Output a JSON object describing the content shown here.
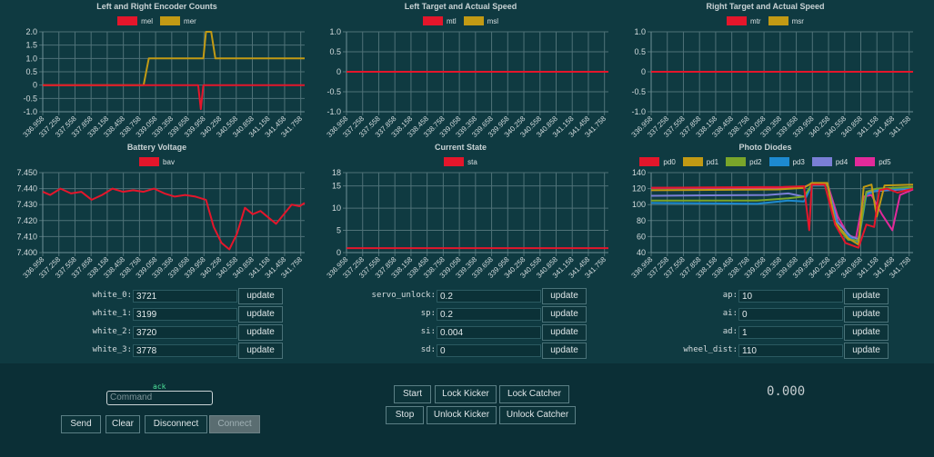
{
  "charts": [
    {
      "title": "Left and Right Encoder Counts",
      "legend": [
        {
          "name": "mel",
          "color": "#e4162b"
        },
        {
          "name": "mer",
          "color": "#c29a14"
        }
      ],
      "yticks": [
        "2.0",
        "1.5",
        "1.0",
        "0.5",
        "0",
        "-0.5",
        "-1.0"
      ]
    },
    {
      "title": "Left Target and Actual Speed",
      "legend": [
        {
          "name": "mtl",
          "color": "#e4162b"
        },
        {
          "name": "msl",
          "color": "#c29a14"
        }
      ],
      "yticks": [
        "1.0",
        "0.5",
        "0",
        "-0.5",
        "-1.0"
      ]
    },
    {
      "title": "Right Target and Actual Speed",
      "legend": [
        {
          "name": "mtr",
          "color": "#e4162b"
        },
        {
          "name": "msr",
          "color": "#c29a14"
        }
      ],
      "yticks": [
        "1.0",
        "0.5",
        "0",
        "-0.5",
        "-1.0"
      ]
    },
    {
      "title": "Battery Voltage",
      "legend": [
        {
          "name": "bav",
          "color": "#e4162b"
        }
      ],
      "yticks": [
        "7.450",
        "7.440",
        "7.430",
        "7.420",
        "7.410",
        "7.400"
      ]
    },
    {
      "title": "Current State",
      "legend": [
        {
          "name": "sta",
          "color": "#e4162b"
        }
      ],
      "yticks": [
        "18",
        "15",
        "10",
        "5",
        "0"
      ]
    },
    {
      "title": "Photo Diodes",
      "legend": [
        {
          "name": "pd0",
          "color": "#e4162b"
        },
        {
          "name": "pd1",
          "color": "#c29a14"
        },
        {
          "name": "pd2",
          "color": "#7aa52a"
        },
        {
          "name": "pd3",
          "color": "#1d8ad0"
        },
        {
          "name": "pd4",
          "color": "#7a7fd6"
        },
        {
          "name": "pd5",
          "color": "#e22a9a"
        }
      ],
      "yticks": [
        "140",
        "120",
        "100",
        "80",
        "60",
        "40"
      ]
    }
  ],
  "xticks": [
    "336.958",
    "337.258",
    "337.558",
    "337.858",
    "338.158",
    "338.458",
    "338.758",
    "339.058",
    "339.358",
    "339.658",
    "339.958",
    "340.258",
    "340.558",
    "340.858",
    "341.158",
    "341.458",
    "341.758"
  ],
  "chart_data": [
    {
      "type": "line",
      "title": "Left and Right Encoder Counts",
      "ylim": [
        -1,
        2
      ],
      "series": [
        {
          "name": "mel",
          "color": "#e4162b",
          "points": [
            [
              336.96,
              0
            ],
            [
              339.95,
              0
            ],
            [
              340.0,
              -0.9
            ],
            [
              340.05,
              0
            ],
            [
              342.0,
              0
            ]
          ]
        },
        {
          "name": "mer",
          "color": "#c29a14",
          "points": [
            [
              336.96,
              0
            ],
            [
              338.9,
              0
            ],
            [
              339.0,
              1
            ],
            [
              339.95,
              1
            ],
            [
              340.05,
              1
            ],
            [
              340.1,
              2
            ],
            [
              340.2,
              2
            ],
            [
              340.28,
              1
            ],
            [
              342.0,
              1
            ]
          ]
        }
      ]
    },
    {
      "type": "line",
      "title": "Left Target and Actual Speed",
      "ylim": [
        -1,
        1
      ],
      "series": [
        {
          "name": "mtl",
          "color": "#e4162b",
          "points": [
            [
              336.96,
              0
            ],
            [
              342.0,
              0
            ]
          ]
        },
        {
          "name": "msl",
          "color": "#c29a14",
          "points": [
            [
              336.96,
              0
            ],
            [
              342.0,
              0
            ]
          ]
        }
      ]
    },
    {
      "type": "line",
      "title": "Right Target and Actual Speed",
      "ylim": [
        -1,
        1
      ],
      "series": [
        {
          "name": "mtr",
          "color": "#e4162b",
          "points": [
            [
              336.96,
              0
            ],
            [
              342.0,
              0
            ]
          ]
        },
        {
          "name": "msr",
          "color": "#c29a14",
          "points": [
            [
              336.96,
              0
            ],
            [
              342.0,
              0
            ]
          ]
        }
      ]
    },
    {
      "type": "line",
      "title": "Battery Voltage",
      "ylim": [
        7.4,
        7.45
      ],
      "series": [
        {
          "name": "bav",
          "color": "#e4162b",
          "points": [
            [
              336.96,
              7.438
            ],
            [
              337.1,
              7.436
            ],
            [
              337.3,
              7.44
            ],
            [
              337.5,
              7.437
            ],
            [
              337.7,
              7.438
            ],
            [
              337.9,
              7.433
            ],
            [
              338.1,
              7.436
            ],
            [
              338.3,
              7.44
            ],
            [
              338.5,
              7.438
            ],
            [
              338.7,
              7.439
            ],
            [
              338.9,
              7.438
            ],
            [
              339.1,
              7.44
            ],
            [
              339.3,
              7.437
            ],
            [
              339.5,
              7.435
            ],
            [
              339.7,
              7.436
            ],
            [
              339.9,
              7.435
            ],
            [
              340.1,
              7.433
            ],
            [
              340.25,
              7.416
            ],
            [
              340.4,
              7.406
            ],
            [
              340.55,
              7.402
            ],
            [
              340.7,
              7.412
            ],
            [
              340.85,
              7.428
            ],
            [
              341.0,
              7.424
            ],
            [
              341.15,
              7.426
            ],
            [
              341.3,
              7.422
            ],
            [
              341.45,
              7.418
            ],
            [
              341.6,
              7.424
            ],
            [
              341.75,
              7.43
            ],
            [
              341.9,
              7.429
            ],
            [
              342.0,
              7.431
            ]
          ]
        }
      ]
    },
    {
      "type": "line",
      "title": "Current State",
      "ylim": [
        0,
        18
      ],
      "series": [
        {
          "name": "sta",
          "color": "#e4162b",
          "points": [
            [
              336.96,
              1
            ],
            [
              342.0,
              1
            ]
          ]
        }
      ]
    },
    {
      "type": "line",
      "title": "Photo Diodes",
      "ylim": [
        40,
        140
      ],
      "series": [
        {
          "name": "pd0",
          "color": "#e4162b",
          "points": [
            [
              336.96,
              121
            ],
            [
              339.5,
              122
            ],
            [
              339.9,
              123
            ],
            [
              340.0,
              68
            ],
            [
              340.05,
              125
            ],
            [
              340.3,
              125
            ],
            [
              340.5,
              75
            ],
            [
              340.7,
              52
            ],
            [
              340.95,
              46
            ],
            [
              341.1,
              75
            ],
            [
              341.25,
              72
            ],
            [
              341.35,
              118
            ],
            [
              341.5,
              120
            ],
            [
              341.7,
              115
            ],
            [
              342.0,
              120
            ]
          ]
        },
        {
          "name": "pd1",
          "color": "#c29a14",
          "points": [
            [
              336.96,
              118
            ],
            [
              339.4,
              119
            ],
            [
              339.9,
              121
            ],
            [
              340.05,
              127
            ],
            [
              340.35,
              127
            ],
            [
              340.5,
              78
            ],
            [
              340.75,
              58
            ],
            [
              340.95,
              50
            ],
            [
              341.05,
              122
            ],
            [
              341.2,
              125
            ],
            [
              341.3,
              85
            ],
            [
              341.45,
              124
            ],
            [
              342.0,
              125
            ]
          ]
        },
        {
          "name": "pd2",
          "color": "#7aa52a",
          "points": [
            [
              336.96,
              105
            ],
            [
              339.0,
              105
            ],
            [
              339.6,
              108
            ],
            [
              339.9,
              110
            ],
            [
              340.05,
              125
            ],
            [
              340.35,
              125
            ],
            [
              340.5,
              75
            ],
            [
              340.75,
              56
            ],
            [
              340.95,
              55
            ],
            [
              341.1,
              116
            ],
            [
              341.3,
              120
            ],
            [
              342.0,
              122
            ]
          ]
        },
        {
          "name": "pd3",
          "color": "#1d8ad0",
          "points": [
            [
              336.96,
              102
            ],
            [
              339.0,
              101
            ],
            [
              339.6,
              105
            ],
            [
              339.9,
              104
            ],
            [
              340.05,
              124
            ],
            [
              340.35,
              124
            ],
            [
              340.55,
              72
            ],
            [
              340.8,
              58
            ],
            [
              340.95,
              53
            ],
            [
              341.1,
              112
            ],
            [
              341.3,
              118
            ],
            [
              342.0,
              121
            ]
          ]
        },
        {
          "name": "pd4",
          "color": "#7a7fd6",
          "points": [
            [
              336.96,
              111
            ],
            [
              339.2,
              112
            ],
            [
              339.6,
              114
            ],
            [
              339.9,
              110
            ],
            [
              340.05,
              124
            ],
            [
              340.35,
              124
            ],
            [
              340.55,
              78
            ],
            [
              340.8,
              60
            ],
            [
              340.95,
              57
            ],
            [
              341.1,
              115
            ],
            [
              341.3,
              117
            ],
            [
              342.0,
              120
            ]
          ]
        },
        {
          "name": "pd5",
          "color": "#e22a9a",
          "points": [
            [
              336.96,
              121
            ],
            [
              339.5,
              121
            ],
            [
              339.9,
              122
            ],
            [
              340.05,
              126
            ],
            [
              340.35,
              126
            ],
            [
              340.55,
              85
            ],
            [
              340.75,
              62
            ],
            [
              340.9,
              58
            ],
            [
              341.05,
              110
            ],
            [
              341.2,
              112
            ],
            [
              341.4,
              88
            ],
            [
              341.6,
              68
            ],
            [
              341.75,
              112
            ],
            [
              342.0,
              119
            ]
          ]
        }
      ]
    }
  ],
  "params": {
    "col1": [
      {
        "label": "white_0:",
        "value": "3721"
      },
      {
        "label": "white_1:",
        "value": "3199"
      },
      {
        "label": "white_2:",
        "value": "3720"
      },
      {
        "label": "white_3:",
        "value": "3778"
      }
    ],
    "col2": [
      {
        "label": "servo_unlock:",
        "value": "0.2"
      },
      {
        "label": "sp:",
        "value": "0.2"
      },
      {
        "label": "si:",
        "value": "0.004"
      },
      {
        "label": "sd:",
        "value": "0"
      }
    ],
    "col3": [
      {
        "label": "ap:",
        "value": "10"
      },
      {
        "label": "ai:",
        "value": "0"
      },
      {
        "label": "ad:",
        "value": "1"
      },
      {
        "label": "wheel_dist:",
        "value": "110"
      }
    ],
    "update_label": "update"
  },
  "controls": {
    "ack": "ack",
    "command_placeholder": "Command",
    "send": "Send",
    "clear": "Clear",
    "disconnect": "Disconnect",
    "connect": "Connect",
    "start": "Start",
    "lock_kicker": "Lock Kicker",
    "lock_catcher": "Lock Catcher",
    "stop": "Stop",
    "unlock_kicker": "Unlock Kicker",
    "unlock_catcher": "Unlock Catcher",
    "display": "0.000"
  }
}
